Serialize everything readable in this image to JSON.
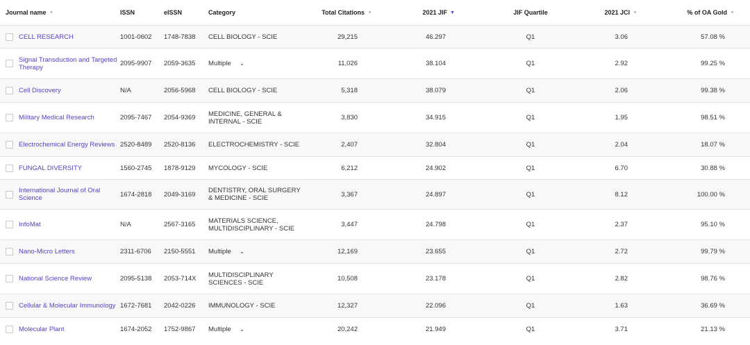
{
  "columns": {
    "name": "Journal name",
    "issn": "ISSN",
    "eissn": "eISSN",
    "category": "Category",
    "citations": "Total Citations",
    "jif": "2021 JIF",
    "quartile": "JIF Quartile",
    "jci": "2021 JCI",
    "oa": "% of OA Gold"
  },
  "rows": [
    {
      "name": "CELL RESEARCH",
      "issn": "1001-0602",
      "eissn": "1748-7838",
      "category": "CELL BIOLOGY - SCIE",
      "citations": "29,215",
      "jif": "46.297",
      "quartile": "Q1",
      "jci": "3.06",
      "oa": "57.08 %",
      "multiple": false
    },
    {
      "name": "Signal Transduction and Targeted Therapy",
      "issn": "2095-9907",
      "eissn": "2059-3635",
      "category": "Multiple",
      "citations": "11,026",
      "jif": "38.104",
      "quartile": "Q1",
      "jci": "2.92",
      "oa": "99.25 %",
      "multiple": true
    },
    {
      "name": "Cell Discovery",
      "issn": "N/A",
      "eissn": "2056-5968",
      "category": "CELL BIOLOGY - SCIE",
      "citations": "5,318",
      "jif": "38.079",
      "quartile": "Q1",
      "jci": "2.06",
      "oa": "99.38 %",
      "multiple": false
    },
    {
      "name": "Military Medical Research",
      "issn": "2095-7467",
      "eissn": "2054-9369",
      "category": "MEDICINE, GENERAL & INTERNAL - SCIE",
      "citations": "3,830",
      "jif": "34.915",
      "quartile": "Q1",
      "jci": "1.95",
      "oa": "98.51 %",
      "multiple": false
    },
    {
      "name": "Electrochemical Energy Reviews",
      "issn": "2520-8489",
      "eissn": "2520-8136",
      "category": "ELECTROCHEMISTRY - SCIE",
      "citations": "2,407",
      "jif": "32.804",
      "quartile": "Q1",
      "jci": "2.04",
      "oa": "18.07 %",
      "multiple": false
    },
    {
      "name": "FUNGAL DIVERSITY",
      "issn": "1560-2745",
      "eissn": "1878-9129",
      "category": "MYCOLOGY - SCIE",
      "citations": "6,212",
      "jif": "24.902",
      "quartile": "Q1",
      "jci": "6.70",
      "oa": "30.88 %",
      "multiple": false
    },
    {
      "name": "International Journal of Oral Science",
      "issn": "1674-2818",
      "eissn": "2049-3169",
      "category": "DENTISTRY, ORAL SURGERY & MEDICINE - SCIE",
      "citations": "3,367",
      "jif": "24.897",
      "quartile": "Q1",
      "jci": "8.12",
      "oa": "100.00 %",
      "multiple": false
    },
    {
      "name": "InfoMat",
      "issn": "N/A",
      "eissn": "2567-3165",
      "category": "MATERIALS SCIENCE, MULTIDISCIPLINARY - SCIE",
      "citations": "3,447",
      "jif": "24.798",
      "quartile": "Q1",
      "jci": "2.37",
      "oa": "95.10 %",
      "multiple": false
    },
    {
      "name": "Nano-Micro Letters",
      "issn": "2311-6706",
      "eissn": "2150-5551",
      "category": "Multiple",
      "citations": "12,169",
      "jif": "23.655",
      "quartile": "Q1",
      "jci": "2.72",
      "oa": "99.79 %",
      "multiple": true
    },
    {
      "name": "National Science Review",
      "issn": "2095-5138",
      "eissn": "2053-714X",
      "category": "MULTIDISCIPLINARY SCIENCES - SCIE",
      "citations": "10,508",
      "jif": "23.178",
      "quartile": "Q1",
      "jci": "2.82",
      "oa": "98.76 %",
      "multiple": false
    },
    {
      "name": "Cellular & Molecular Immunology",
      "issn": "1672-7681",
      "eissn": "2042-0226",
      "category": "IMMUNOLOGY - SCIE",
      "citations": "12,327",
      "jif": "22.096",
      "quartile": "Q1",
      "jci": "1.63",
      "oa": "36.69 %",
      "multiple": false
    },
    {
      "name": "Molecular Plant",
      "issn": "1674-2052",
      "eissn": "1752-9867",
      "category": "Multiple",
      "citations": "20,242",
      "jif": "21.949",
      "quartile": "Q1",
      "jci": "3.71",
      "oa": "21.13 %",
      "multiple": true
    }
  ],
  "icons": {
    "sort": "sort-caret-icon",
    "checkbox": "checkbox",
    "chevron": "chevron-down-icon"
  },
  "colors": {
    "link": "#5a3fc0",
    "active_sort": "#5a3fc0"
  }
}
